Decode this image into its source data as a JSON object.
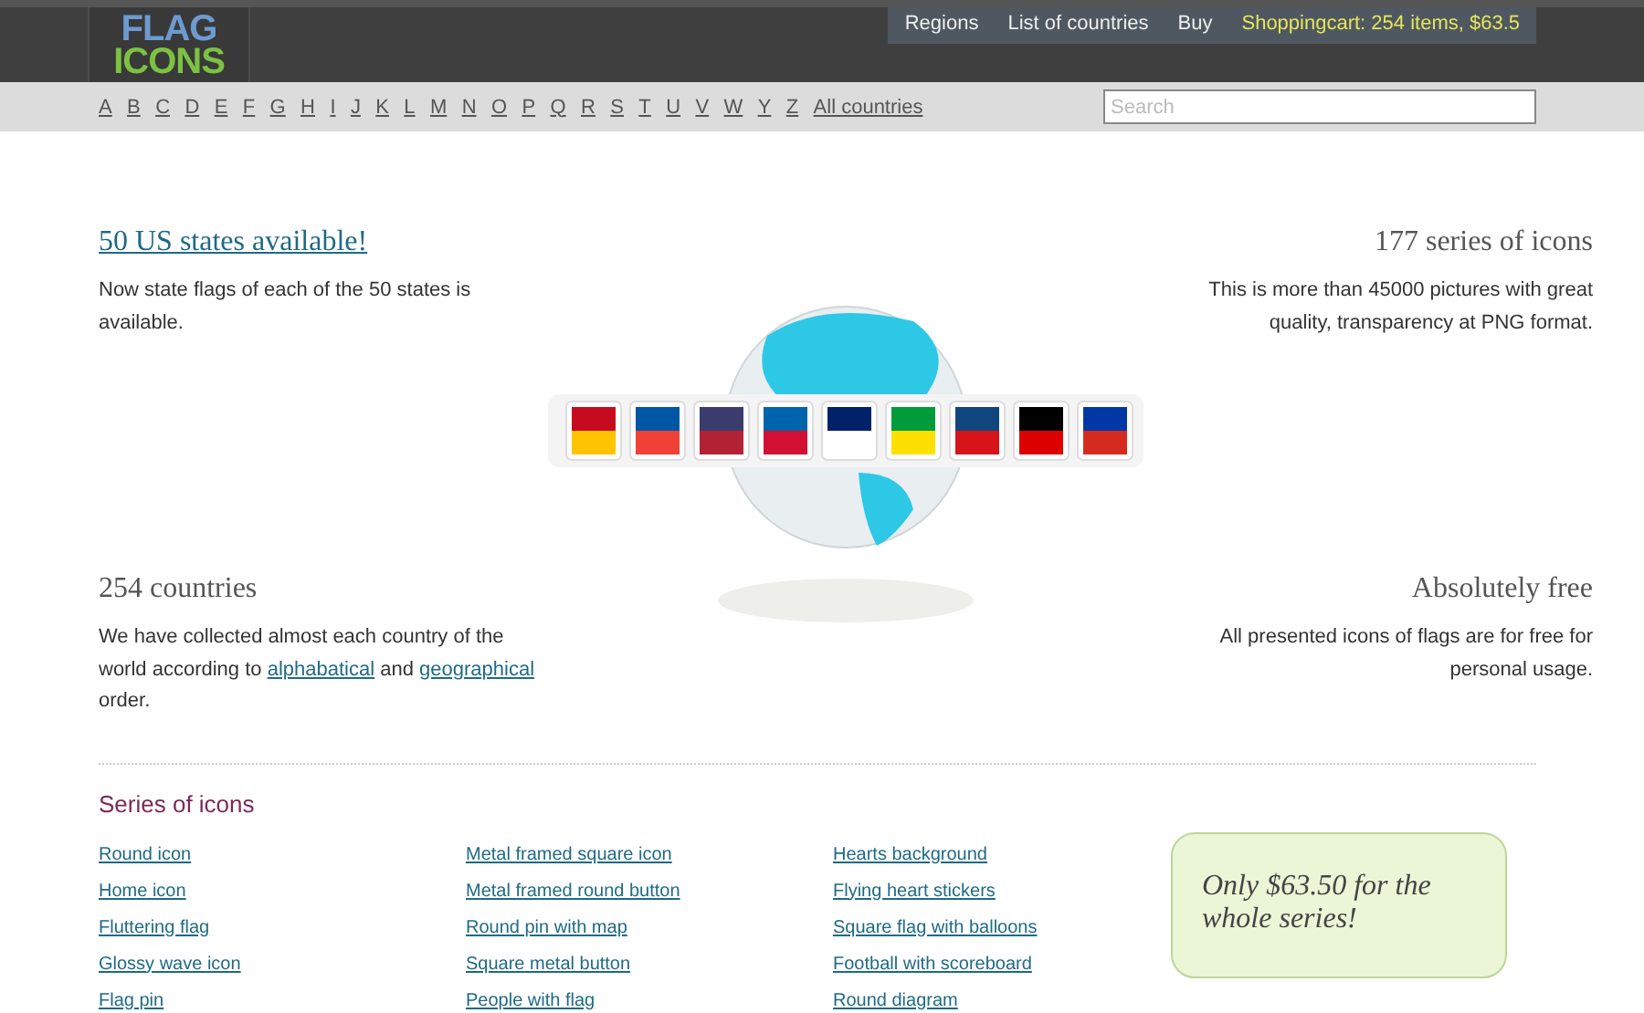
{
  "logo": {
    "line_1": "FLAG",
    "line_2": "ICONS"
  },
  "nav": [
    {
      "label": "Regions",
      "kind": "link"
    },
    {
      "label": "List of countries",
      "kind": "link"
    },
    {
      "label": "Buy",
      "kind": "link"
    },
    {
      "label": "Shoppingcart: 254 items, $63.5",
      "kind": "cart"
    }
  ],
  "letters": [
    "A",
    "B",
    "C",
    "D",
    "E",
    "F",
    "G",
    "H",
    "I",
    "J",
    "K",
    "L",
    "M",
    "N",
    "O",
    "P",
    "Q",
    "R",
    "S",
    "T",
    "U",
    "V",
    "W",
    "Y",
    "Z",
    "All countries"
  ],
  "search": {
    "placeholder": "Search"
  },
  "features": [
    {
      "title": "50 US states available!",
      "title_link": true,
      "text": [
        {
          "t": "Now state flags of each of the 50 states is available.",
          "link": false
        }
      ]
    },
    {
      "title": "177 series of icons",
      "title_link": false,
      "text": [
        {
          "t": "This is more than 45000 pictures with great quality, transparency at PNG format.",
          "link": false
        }
      ]
    },
    {
      "title": "254 countries",
      "title_link": false,
      "text": [
        {
          "t": "We have collected almost each country of the world according to ",
          "link": false
        },
        {
          "t": "alphabatical",
          "link": true
        },
        {
          "t": " and ",
          "link": false
        },
        {
          "t": "geographical",
          "link": true
        },
        {
          "t": " order.",
          "link": false
        }
      ]
    },
    {
      "title": "Absolutely free",
      "title_link": false,
      "text": [
        {
          "t": "All presented icons of flags are for free for personal usage.",
          "link": false
        }
      ]
    }
  ],
  "series": {
    "title": "Series of icons",
    "columns": [
      [
        "Round icon",
        "Home icon",
        "Fluttering flag",
        "Glossy wave icon",
        "Flag pin"
      ],
      [
        "Metal framed square icon",
        "Metal framed round button",
        "Round pin with map",
        "Square metal button",
        "People with flag"
      ],
      [
        "Hearts background",
        "Flying heart stickers",
        "Square flag with balloons",
        "Football with scoreboard",
        "Round diagram"
      ]
    ],
    "promo": "Only $63.50 for the whole series!"
  }
}
